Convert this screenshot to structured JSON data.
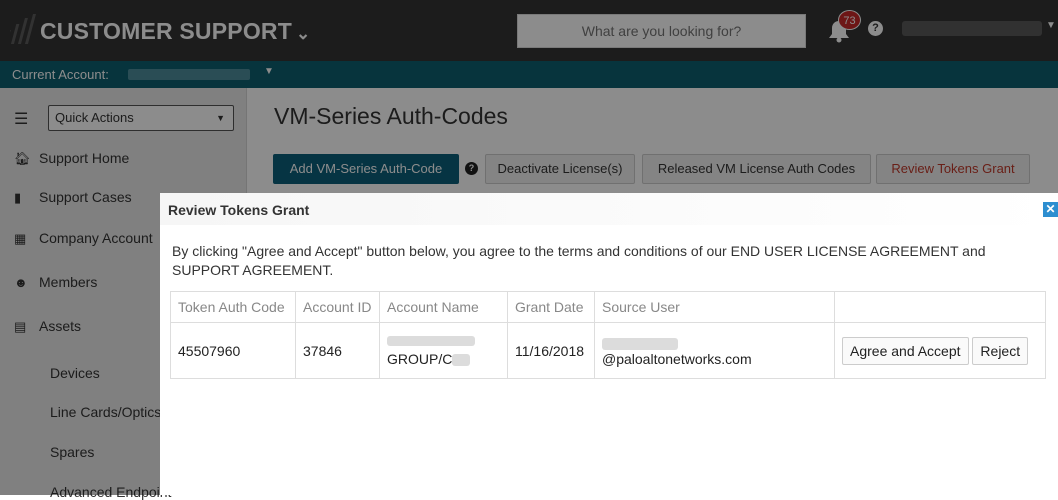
{
  "header": {
    "brand": "CUSTOMER SUPPORT",
    "search_placeholder": "What are you looking for?",
    "notification_count": "73"
  },
  "account_bar": {
    "label": "Current Account:"
  },
  "sidebar": {
    "quick_actions": "Quick Actions",
    "items": [
      {
        "label": "Support Home",
        "icon": "home-icon"
      },
      {
        "label": "Support Cases",
        "icon": "briefcase-icon"
      },
      {
        "label": "Company Account",
        "icon": "building-icon"
      },
      {
        "label": "Members",
        "icon": "users-icon"
      },
      {
        "label": "Assets",
        "icon": "list-icon"
      }
    ],
    "subitems": [
      {
        "label": "Devices"
      },
      {
        "label": "Line Cards/Optics"
      },
      {
        "label": "Spares"
      },
      {
        "label": "Advanced Endpoint"
      }
    ]
  },
  "main": {
    "title": "VM-Series Auth-Codes",
    "buttons": {
      "add": "Add VM-Series Auth-Code",
      "deactivate": "Deactivate License(s)",
      "released": "Released VM License Auth Codes",
      "review": "Review Tokens Grant"
    }
  },
  "modal": {
    "title": "Review Tokens Grant",
    "text": "By clicking \"Agree and Accept\" button below, you agree to the terms and conditions of our END USER LICENSE AGREEMENT and SUPPORT AGREEMENT.",
    "columns": [
      "Token Auth Code",
      "Account ID",
      "Account Name",
      "Grant Date",
      "Source User",
      ""
    ],
    "row": {
      "token_auth_code": "45507960",
      "account_id": "37846",
      "account_name": "GROUP/C",
      "grant_date": "11/16/2018",
      "source_user": "@paloaltonetworks.com",
      "agree_label": "Agree and Accept",
      "reject_label": "Reject"
    }
  },
  "colors": {
    "topbar": "#333333",
    "account_bar": "#0e5f70",
    "primary_button": "#0c5f7a",
    "danger_text": "#c0392b",
    "badge": "#c62828",
    "close_button": "#2d8ed0"
  }
}
